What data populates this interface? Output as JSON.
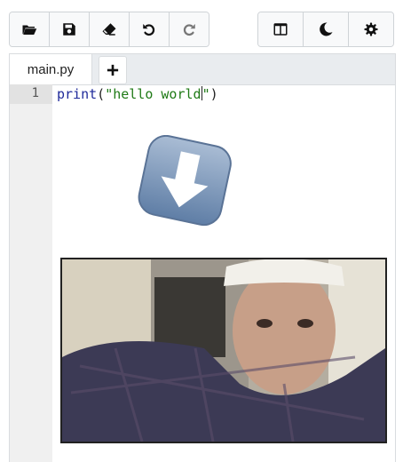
{
  "toolbar": {
    "left": [
      {
        "icon": "folder-open-icon"
      },
      {
        "icon": "save-icon"
      },
      {
        "icon": "eraser-icon"
      },
      {
        "icon": "undo-icon"
      },
      {
        "icon": "redo-icon"
      }
    ],
    "right": [
      {
        "icon": "split-view-icon"
      },
      {
        "icon": "dark-mode-moon-icon"
      },
      {
        "icon": "settings-gear-icon"
      }
    ]
  },
  "tabs": {
    "active": "main.py",
    "add_label": "+"
  },
  "editor": {
    "line_number": "1",
    "code": {
      "func": "print",
      "open": "(",
      "string_start": "\"hello world",
      "string_end": "\"",
      "close": ")"
    }
  },
  "colors": {
    "keyword": "#1f2a9a",
    "string": "#1f7a16",
    "download_badge": "#7d96b8"
  },
  "overlay": {
    "icon": "download-arrow-icon"
  },
  "media": {
    "type": "webcam-video"
  }
}
